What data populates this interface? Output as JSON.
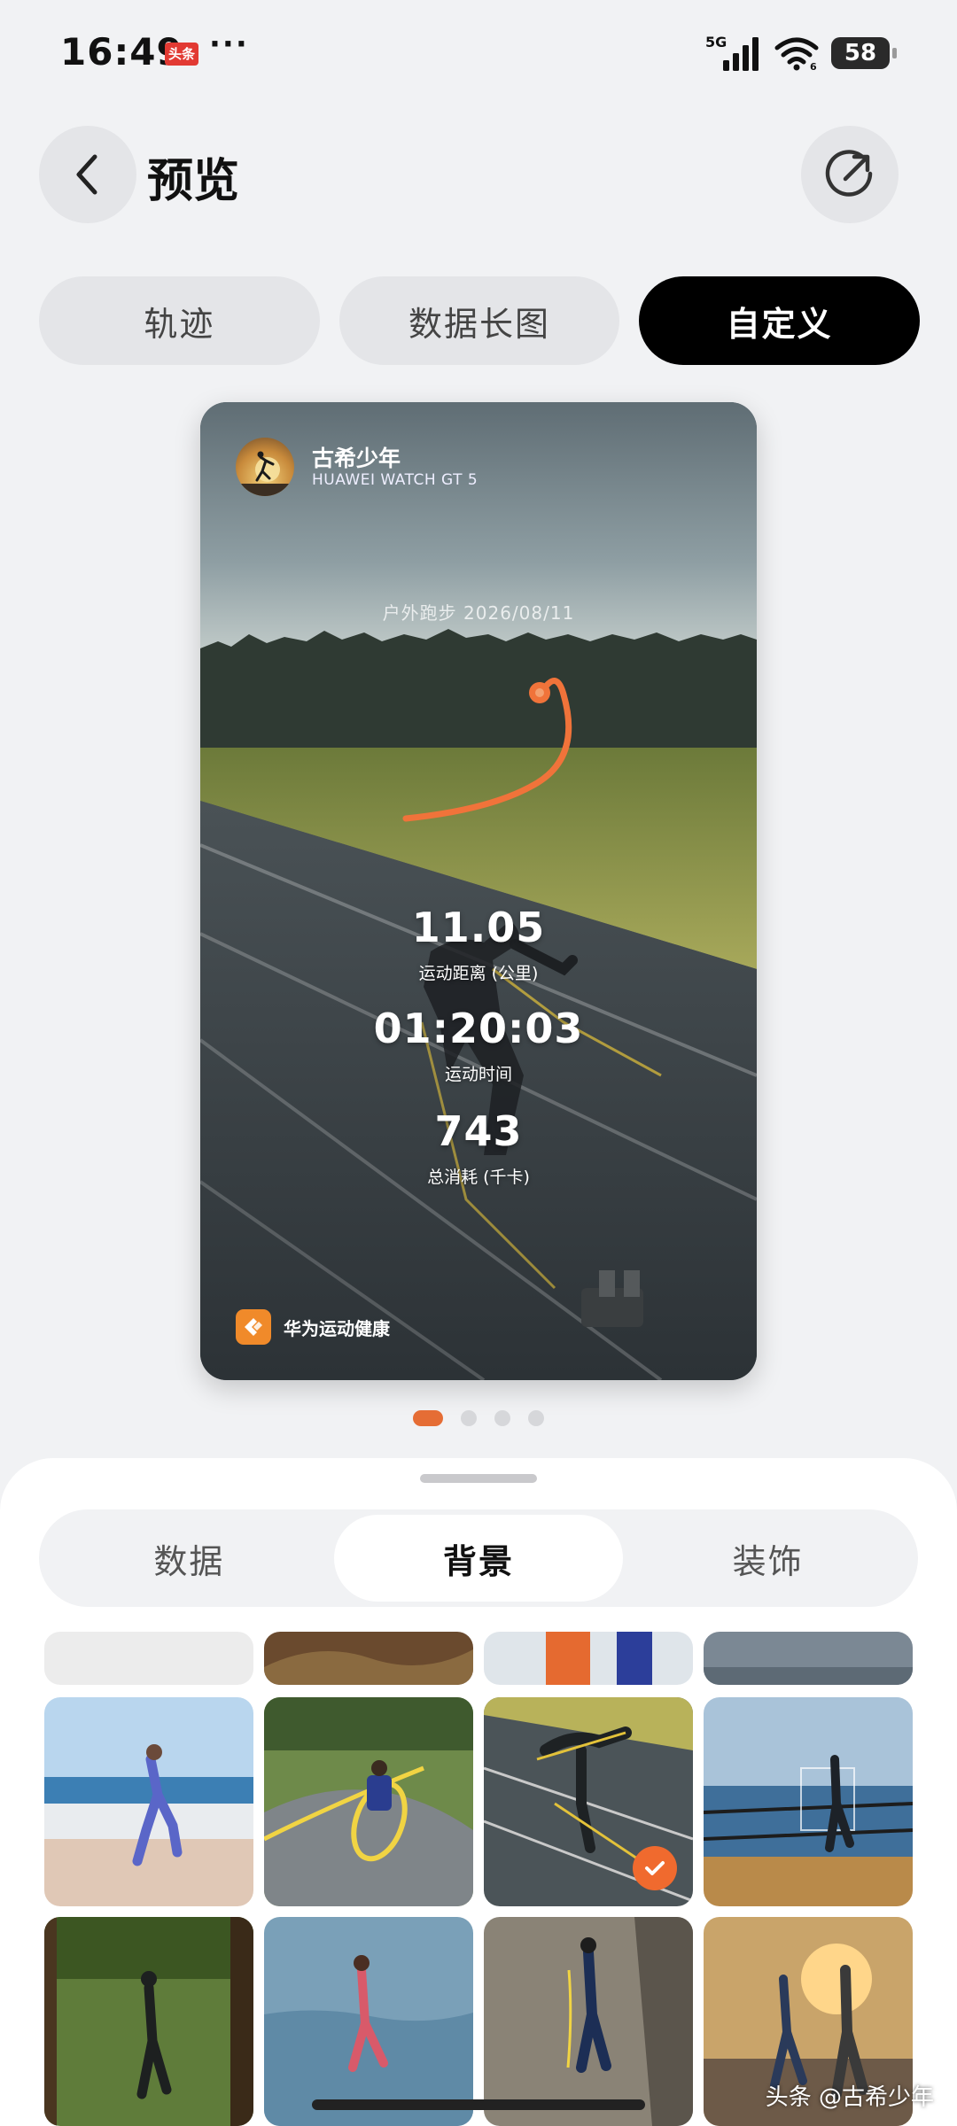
{
  "status_bar": {
    "time": "16:49",
    "app_badge": "头条",
    "more": "···",
    "network": "5G",
    "battery": "58"
  },
  "header": {
    "title": "预览"
  },
  "mode_tabs": [
    {
      "label": "轨迹",
      "active": false
    },
    {
      "label": "数据长图",
      "active": false
    },
    {
      "label": "自定义",
      "active": true
    }
  ],
  "card": {
    "user_name": "古希少年",
    "device": "HUAWEI WATCH GT 5",
    "activity": "户外跑步 2026/08/11",
    "stats": [
      {
        "value": "11.05",
        "label": "运动距离 (公里)"
      },
      {
        "value": "01:20:03",
        "label": "运动时间"
      },
      {
        "value": "743",
        "label": "总消耗 (千卡)"
      }
    ],
    "brand": "华为运动健康",
    "route_color": "#f0733a"
  },
  "page_indicator": {
    "count": 4,
    "active": 1
  },
  "sheet_tabs": [
    {
      "label": "数据",
      "active": false
    },
    {
      "label": "背景",
      "active": true
    },
    {
      "label": "装饰",
      "active": false
    }
  ],
  "backgrounds": {
    "selected_index": 6,
    "thumbnails": [
      "track-runner",
      "seaside-runner-woman",
      "park-path-runner",
      "track-sprinter",
      "boardwalk-runner",
      "forest-runner",
      "beach-runner",
      "road-runner",
      "sunset-runners"
    ]
  },
  "watermark": "头条 @古希少年",
  "accent": "#e56d35"
}
